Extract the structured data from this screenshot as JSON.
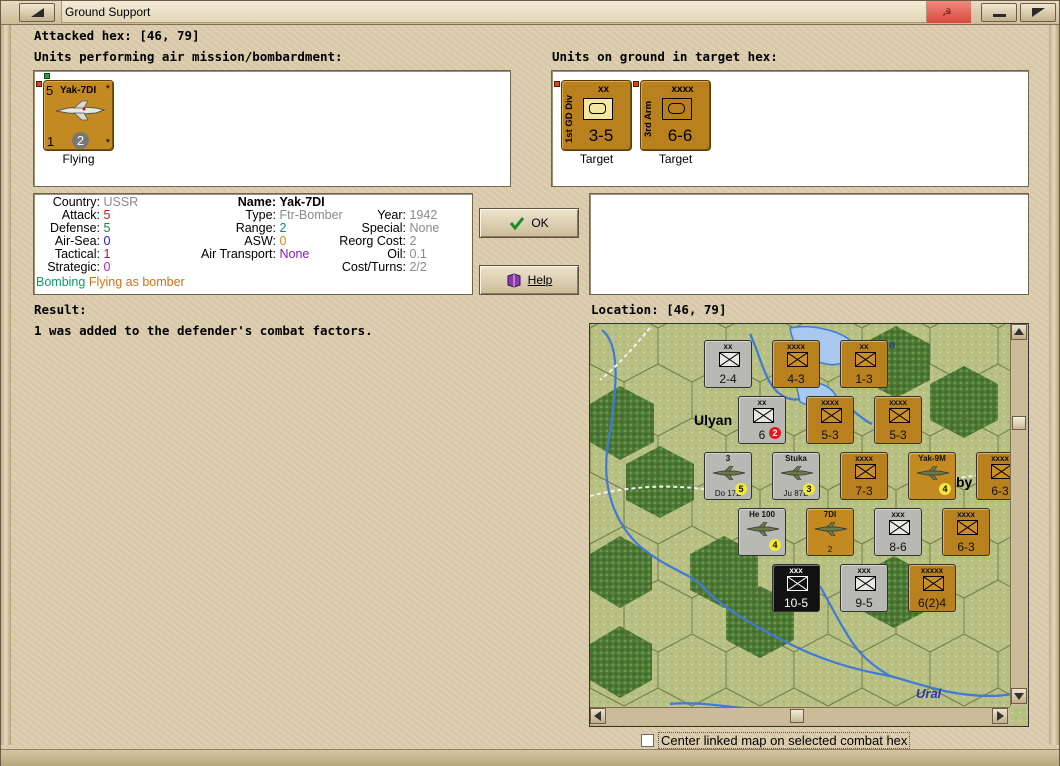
{
  "window": {
    "title": "Ground Support"
  },
  "attacked_hex": {
    "label": "Attacked hex:",
    "value": "[46, 79]"
  },
  "air_units": {
    "label": "Units performing air mission/bombardment:",
    "items": [
      {
        "name": "Yak-7DI",
        "top_left": "5",
        "top_right": "*",
        "bottom_left": "1",
        "bottom_center": "2",
        "bottom_right": "*",
        "status": "Flying"
      }
    ]
  },
  "ground_units": {
    "label": "Units on ground in target hex:",
    "items": [
      {
        "size": "xx",
        "name": "1st GD Div",
        "strength": "3-5",
        "status": "Target",
        "symbol": "infantry-box"
      },
      {
        "size": "xxxx",
        "name": "3rd Arm",
        "strength": "6-6",
        "status": "Target",
        "symbol": "armor-box"
      }
    ]
  },
  "unit_info": {
    "col1": [
      {
        "key": "Country:",
        "value": "USSR",
        "color": "#8a8a8a"
      },
      {
        "key": "Attack:",
        "value": "5",
        "color": "#d01818"
      },
      {
        "key": "Defense:",
        "value": "5",
        "color": "#108a3a"
      },
      {
        "key": "Air-Sea:",
        "value": "0",
        "color": "#1818c8"
      },
      {
        "key": "Tactical:",
        "value": "1",
        "color": "#b01030"
      },
      {
        "key": "Strategic:",
        "value": "0",
        "color": "#c020c0"
      }
    ],
    "col2": [
      {
        "key": "Name:",
        "value": "Yak-7DI",
        "color": "#000000",
        "bold": true
      },
      {
        "key": "Type:",
        "value": "Ftr-Bomber",
        "color": "#8a8a8a"
      },
      {
        "key": "Range:",
        "value": "2",
        "color": "#108a8a"
      },
      {
        "key": "ASW:",
        "value": "0",
        "color": "#e08a10"
      },
      {
        "key": "Air Transport:",
        "value": "None",
        "color": "#8a18c8"
      }
    ],
    "col3": [
      {
        "key": "Year:",
        "value": "1942",
        "color": "#8a8a8a"
      },
      {
        "key": "Special:",
        "value": "None",
        "color": "#8a8a8a"
      },
      {
        "key": "Reorg Cost:",
        "value": "2",
        "color": "#8a8a8a"
      },
      {
        "key": "Oil:",
        "value": "0.1",
        "color": "#8a8a8a"
      },
      {
        "key": "Cost/Turns:",
        "value": "2/2",
        "color": "#8a8a8a"
      }
    ],
    "mission_1": {
      "text": "Bombing",
      "color": "#109a6a"
    },
    "mission_2": {
      "text": "Flying as bomber",
      "color": "#d0701a"
    }
  },
  "buttons": {
    "ok": "OK",
    "help": "Help"
  },
  "result": {
    "label": "Result:",
    "text": "1 was added to the defender's combat factors."
  },
  "location": {
    "label": "Location:",
    "value": "[46, 79]"
  },
  "map": {
    "place_labels": [
      "Ulyan",
      "by",
      "Ural"
    ],
    "river_label": "a",
    "units": [
      {
        "top": "xx",
        "strength": "2-4",
        "kind": "grey"
      },
      {
        "top": "xxxx",
        "strength": "4-3",
        "kind": "orange"
      },
      {
        "top": "xx",
        "strength": "1-3",
        "kind": "orange"
      },
      {
        "top": "xx",
        "strength": "6",
        "badge": "2",
        "kind": "grey"
      },
      {
        "top": "xxxx",
        "strength": "5-3",
        "kind": "orange"
      },
      {
        "top": "xxxx",
        "strength": "5-3",
        "kind": "orange"
      },
      {
        "top": "3",
        "strength": "Do 17Z",
        "badge": "5",
        "kind": "grey-air"
      },
      {
        "top": "Stuka",
        "strength": "Ju 87B",
        "badge": "3",
        "kind": "grey-air"
      },
      {
        "top": "xxxx",
        "strength": "7-3",
        "kind": "orange"
      },
      {
        "top": "Yak-9M",
        "strength": "",
        "badge": "4",
        "kind": "orange-air"
      },
      {
        "top": "xxxx",
        "strength": "6-3",
        "kind": "orange"
      },
      {
        "top": "He 100",
        "strength": "",
        "badge": "4",
        "kind": "grey-air"
      },
      {
        "top": "7DI",
        "strength": "2",
        "kind": "orange-air"
      },
      {
        "top": "xxx",
        "strength": "8-6",
        "kind": "grey"
      },
      {
        "top": "xxxx",
        "strength": "6-3",
        "kind": "orange"
      },
      {
        "top": "xxx",
        "strength": "10-5",
        "kind": "black"
      },
      {
        "top": "xxx",
        "strength": "9-5",
        "kind": "grey"
      },
      {
        "top": "xxxxx",
        "strength": "6(2)4",
        "kind": "orange"
      }
    ]
  },
  "options": {
    "center_linked_map": "Center linked map on selected combat hex"
  }
}
